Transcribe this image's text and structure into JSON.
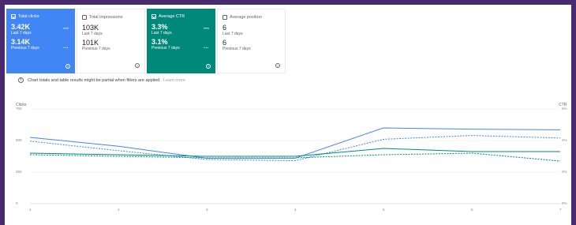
{
  "cards": [
    {
      "title": "Total clicks",
      "value": "3.42K",
      "period1": "Last 7 days",
      "value2": "3.14K",
      "period2": "Previous 7 days",
      "checked": true,
      "style": "blue"
    },
    {
      "title": "Total impressions",
      "value": "103K",
      "period1": "Last 7 days",
      "value2": "101K",
      "period2": "Previous 7 days",
      "checked": false,
      "style": "white"
    },
    {
      "title": "Average CTR",
      "value": "3.3%",
      "period1": "Last 7 days",
      "value2": "3.1%",
      "period2": "Previous 7 days",
      "checked": true,
      "style": "green"
    },
    {
      "title": "Average position",
      "value": "6",
      "period1": "Last 7 days",
      "value2": "6",
      "period2": "Previous 7 days",
      "checked": false,
      "style": "white"
    }
  ],
  "notice": {
    "text": "Chart totals and table results might be partial when filters are applied.",
    "link": "Learn more"
  },
  "chart_data": {
    "type": "line",
    "ylabel_left": "Clicks",
    "ylabel_right": "CTR",
    "x": [
      "1",
      "2",
      "3",
      "4",
      "5",
      "6",
      "7"
    ],
    "y_ticks_left": [
      "750",
      "500",
      "250",
      "0"
    ],
    "y_ticks_right": [
      "6%",
      "4%",
      "2%",
      "0%"
    ],
    "ylim_left": [
      0,
      750
    ],
    "ylim_right": [
      0,
      6
    ],
    "series": [
      {
        "axis": "left",
        "color": "#4285f4",
        "dashed": false,
        "values": [
          525,
          455,
          360,
          360,
          600,
          590,
          585
        ]
      },
      {
        "axis": "left",
        "color": "#4285f4",
        "dashed": true,
        "values": [
          495,
          420,
          350,
          340,
          510,
          540,
          520
        ]
      },
      {
        "axis": "right",
        "color": "#00897b",
        "dashed": false,
        "values": [
          3.2,
          3.1,
          3.0,
          3.0,
          3.5,
          3.3,
          3.3
        ]
      },
      {
        "axis": "right",
        "color": "#00897b",
        "dashed": true,
        "values": [
          3.1,
          3.0,
          2.9,
          2.9,
          3.1,
          3.2,
          2.7
        ]
      }
    ]
  }
}
